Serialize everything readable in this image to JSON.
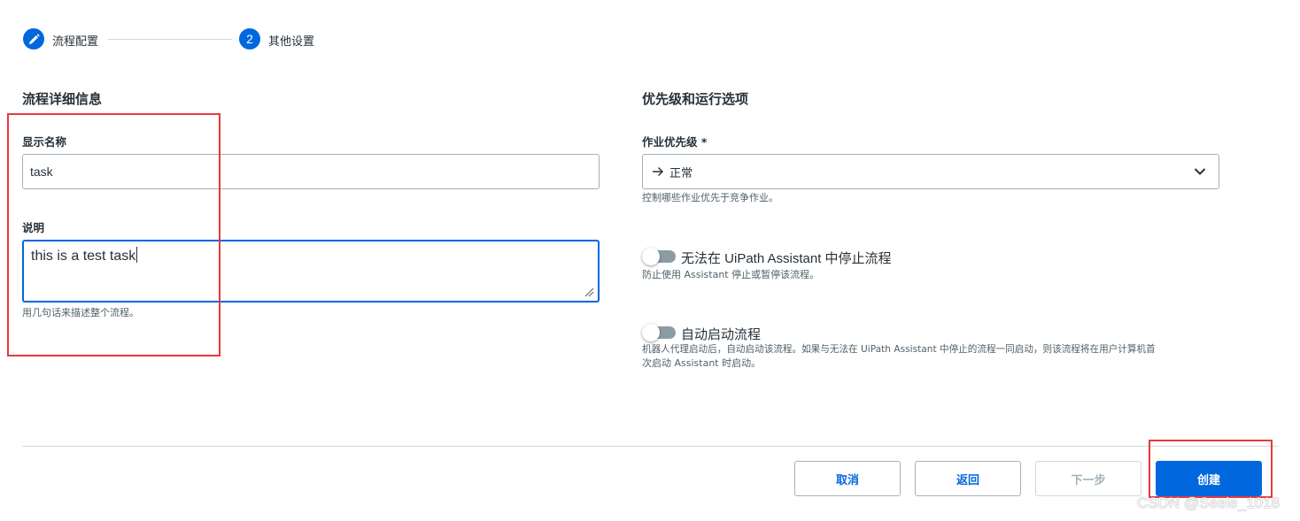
{
  "stepper": {
    "step1": {
      "label": "流程配置",
      "icon": "pencil-icon"
    },
    "step2": {
      "number": "2",
      "label": "其他设置"
    }
  },
  "left": {
    "section_title": "流程详细信息",
    "display_name": {
      "label": "显示名称",
      "value": "task"
    },
    "description": {
      "label": "说明",
      "value": "this is a test task",
      "help": "用几句话来描述整个流程。"
    }
  },
  "right": {
    "section_title": "优先级和运行选项",
    "priority": {
      "label": "作业优先级 *",
      "value": "正常",
      "value_icon": "arrow-right-icon",
      "help": "控制哪些作业优先于竞争作业。"
    },
    "toggle1": {
      "label": "无法在 UiPath Assistant 中停止流程",
      "help": "防止使用 Assistant 停止或暂停该流程。",
      "checked": false
    },
    "toggle2": {
      "label": "自动启动流程",
      "help_line1": "机器人代理启动后，自动启动该流程。如果与无法在 UiPath Assistant 中停止的流程一同启动，则该流程将在用户计算机首",
      "help_line2": "次启动 Assistant 时启动。",
      "checked": false
    }
  },
  "footer": {
    "cancel": "取消",
    "back": "返回",
    "next": "下一步",
    "create": "创建"
  },
  "watermark": "CSDN @Seele_1018",
  "colors": {
    "accent": "#0067df",
    "highlight": "#e8383d"
  }
}
